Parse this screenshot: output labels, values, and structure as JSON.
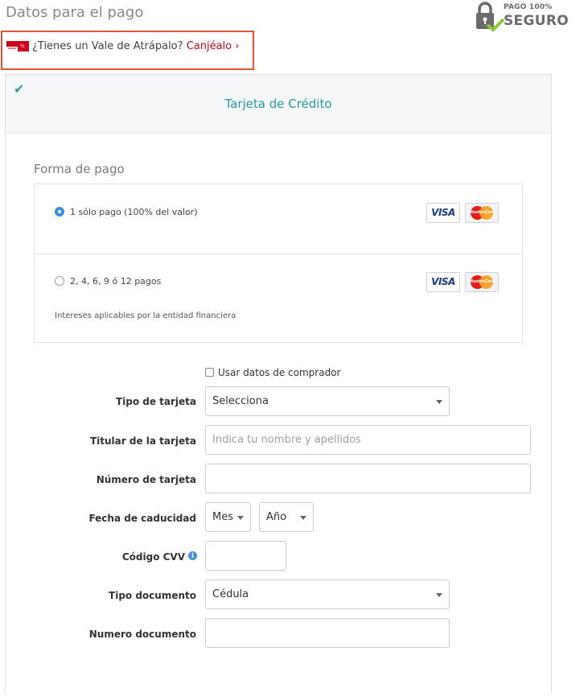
{
  "header": {
    "title": "Datos para el pago",
    "secure_badge": {
      "line1": "PAGO 100%",
      "line2": "SEGURO",
      "icon": "lock-icon"
    }
  },
  "voucher": {
    "question": "¿Tienes un Vale de Atrápalo?",
    "link": "Canjéalo ›",
    "highlight_color": "#e8503a"
  },
  "payment_panel": {
    "tab_title": "Tarjeta de Crédito",
    "accent_color": "#2a9aa3",
    "forma_de_pago_label": "Forma de pago",
    "options": [
      {
        "label": "1 sólo pago (100% del valor)",
        "selected": true,
        "note": ""
      },
      {
        "label": "2, 4, 6, 9 ó 12 pagos",
        "selected": false,
        "note": "Intereses aplicables por la entidad financiera"
      }
    ],
    "cards": {
      "visa": "VISA",
      "mastercard": "MasterCard"
    }
  },
  "form": {
    "use_buyer_data": {
      "label": "Usar datos de comprador",
      "checked": false
    },
    "card_type": {
      "label": "Tipo de tarjeta",
      "value": "Selecciona"
    },
    "holder": {
      "label": "Titular de la tarjeta",
      "placeholder": "Indica tu nombre y apellidos",
      "value": ""
    },
    "card_number": {
      "label": "Número de tarjeta",
      "value": ""
    },
    "expiry": {
      "label": "Fecha de caducidad",
      "month": "Mes",
      "year": "Año"
    },
    "cvv": {
      "label": "Código CVV",
      "value": ""
    },
    "doc_type": {
      "label": "Tipo documento",
      "value": "Cédula"
    },
    "doc_number": {
      "label": "Numero documento",
      "value": ""
    }
  }
}
